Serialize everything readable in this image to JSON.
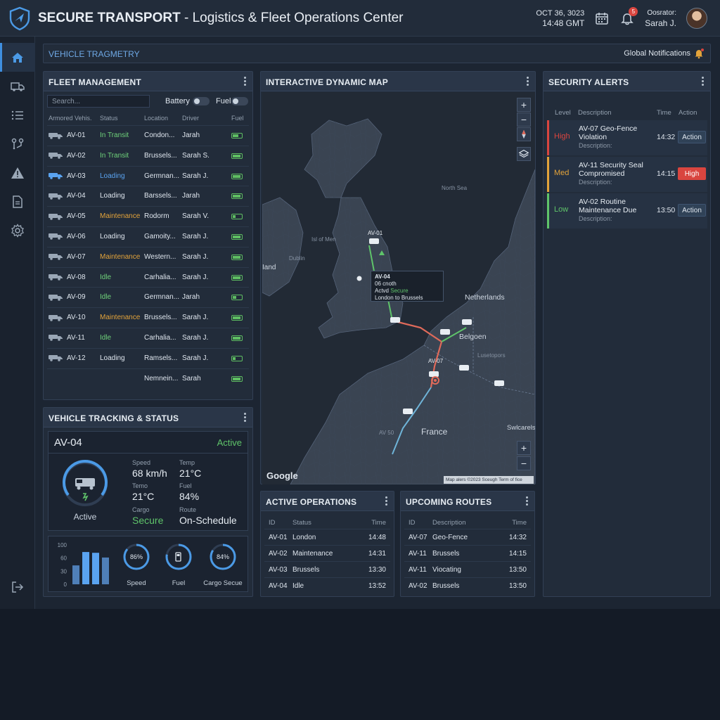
{
  "header": {
    "brand": "SECURE TRANSPORT",
    "subtitle": " - Logistics & Fleet Operations Center",
    "date": "OCT 36, 3023",
    "time": "14:48 GMT",
    "notification_count": "5",
    "operator_label": "Oosrator:",
    "operator_name": "Sarah J."
  },
  "sidebar": {
    "items": [
      {
        "icon": "home-icon"
      },
      {
        "icon": "truck-icon"
      },
      {
        "icon": "list-icon"
      },
      {
        "icon": "route-icon"
      },
      {
        "icon": "warning-icon"
      },
      {
        "icon": "document-icon"
      },
      {
        "icon": "gear-icon"
      }
    ],
    "exit_icon": "logout-icon"
  },
  "telemetry_bar": {
    "label": "VEHICLE TRAGMETRY",
    "notifications": "Global Notifications"
  },
  "fleet": {
    "title": "FLEET MANAGEMENT",
    "search_placeholder": "Search...",
    "battery_label": "Battery",
    "fuel_label": "Fuel",
    "columns": [
      "Armored Vehis.",
      "Status",
      "Location",
      "Driver",
      "Fuel"
    ],
    "rows": [
      {
        "id": "AV-01",
        "status": "In Transit",
        "status_kind": "transit",
        "location": "Condon...",
        "driver": "Jarah",
        "fuel": 0.7
      },
      {
        "id": "AV-02",
        "status": "In Transit",
        "status_kind": "transit",
        "location": "Brussels...",
        "driver": "Sarah S.",
        "fuel": 0.9
      },
      {
        "id": "AV-03",
        "status": "Loading",
        "status_kind": "loading-b",
        "location": "Germnan...",
        "driver": "Sarah J.",
        "fuel": 0.9
      },
      {
        "id": "AV-04",
        "status": "Loading",
        "status_kind": "loading",
        "location": "Barssels...",
        "driver": "Jarah",
        "fuel": 0.9
      },
      {
        "id": "AV-05",
        "status": "Maintenance",
        "status_kind": "maint",
        "location": "Rodorm",
        "driver": "Sarah V.",
        "fuel": 0.3
      },
      {
        "id": "AV-06",
        "status": "Loading",
        "status_kind": "loading",
        "location": "Gamoity...",
        "driver": "Sarah J.",
        "fuel": 0.9
      },
      {
        "id": "AV-07",
        "status": "Maintenance",
        "status_kind": "maint",
        "location": "Western...",
        "driver": "Sarah J.",
        "fuel": 0.9
      },
      {
        "id": "AV-08",
        "status": "Idle",
        "status_kind": "idle",
        "location": "Carhalia...",
        "driver": "Sarah J.",
        "fuel": 0.9
      },
      {
        "id": "AV-09",
        "status": "Idle",
        "status_kind": "idle",
        "location": "Germnan...",
        "driver": "Jarah",
        "fuel": 0.4
      },
      {
        "id": "AV-10",
        "status": "Maintenance",
        "status_kind": "maint",
        "location": "Brussels...",
        "driver": "Sarah J.",
        "fuel": 0.9
      },
      {
        "id": "AV-11",
        "status": "Idle",
        "status_kind": "idle",
        "location": "Carhalia...",
        "driver": "Sarah J.",
        "fuel": 0.9
      },
      {
        "id": "AV-12",
        "status": "Loading",
        "status_kind": "loading",
        "location": "Ramsels...",
        "driver": "Sarah J.",
        "fuel": 0.3
      },
      {
        "id": "",
        "status": "",
        "status_kind": "",
        "location": "Nemnein...",
        "driver": "Sarah",
        "fuel": 0.9
      }
    ]
  },
  "tracking": {
    "title": "VEHICLE TRACKING & STATUS",
    "vehicle_id": "AV-04",
    "status": "Active",
    "gauge_label": "Active",
    "stats": [
      {
        "label": "Speed",
        "value": "68 km/h"
      },
      {
        "label": "Temp",
        "value": "21°C"
      },
      {
        "label": "Temo",
        "value": "21°C"
      },
      {
        "label": "Fuel",
        "value": "84%"
      },
      {
        "label": "Cargo",
        "value": "Secure"
      },
      {
        "label": "Route",
        "value": "On-Schedule"
      }
    ],
    "bar_chart": {
      "ticks": [
        "100",
        "60",
        "30",
        "0"
      ],
      "values": [
        48,
        82,
        80,
        68
      ]
    },
    "rings": [
      {
        "label": "Speed",
        "value": "86%",
        "pct": 0.86
      },
      {
        "label": "Fuel",
        "value": "",
        "pct": 0.78
      },
      {
        "label": "Cargo Secue",
        "value": "84%",
        "pct": 0.84
      }
    ]
  },
  "map": {
    "title": "INTERACTIVE DYNAMIC MAP",
    "labels": {
      "north_sea": "North Sea",
      "isle_of_man": "Isl of Men",
      "ireland": "Iand",
      "dublin": "Dublin",
      "netherlands": "Netherlands",
      "belgium": "Belgoen",
      "luxembourg": "Lusetopors",
      "france": "France",
      "switzerland": "Swlcarels"
    },
    "markers": {
      "av01": "AV-01",
      "av07": "AV-07",
      "av50": "AV 50"
    },
    "tooltip": {
      "id": "AV-04",
      "line1": "06 cnoth",
      "status_label": "Actvd",
      "status": "Secure",
      "route": "London to Brussels"
    },
    "attribution": "Google",
    "credit": "Map alers ©2023 Sceugh    Term of fice"
  },
  "alerts": {
    "title": "SECURITY ALERTS",
    "columns": [
      "Level",
      "Description",
      "Time",
      "Action"
    ],
    "rows": [
      {
        "level": "High",
        "color": "#d9453f",
        "line1": "AV-07 Geo-Fence",
        "line2": "Violation",
        "sub": "Description:",
        "time": "14:32",
        "action": "Action",
        "action_red": false
      },
      {
        "level": "Med",
        "color": "#e3a33a",
        "line1": "AV-11 Security Seal",
        "line2": "Compromised",
        "sub": "Description:",
        "time": "14:15",
        "action": "High",
        "action_red": true
      },
      {
        "level": "Low",
        "color": "#5fc46a",
        "line1": "AV-02 Routine",
        "line2": "Maintenance Due",
        "sub": "Description:",
        "time": "13:50",
        "action": "Action",
        "action_red": false
      }
    ]
  },
  "active_ops": {
    "title": "ACTIVE OPERATIONS",
    "columns": [
      "ID",
      "Status",
      "Time"
    ],
    "rows": [
      {
        "id": "AV-01",
        "status": "London",
        "time": "14:48"
      },
      {
        "id": "AV-02",
        "status": "Maintenance",
        "time": "14:31"
      },
      {
        "id": "AV-03",
        "status": "Brussels",
        "time": "13:30"
      },
      {
        "id": "AV-04",
        "status": "Idle",
        "time": "13:52"
      }
    ]
  },
  "upcoming": {
    "title": "UPCOMING ROUTES",
    "columns": [
      "ID",
      "Description",
      "Time"
    ],
    "rows": [
      {
        "id": "AV-07",
        "status": "Geo-Fence",
        "time": "14:32"
      },
      {
        "id": "AV-11",
        "status": "Brussels",
        "time": "14:15"
      },
      {
        "id": "AV-11",
        "status": "Viocating",
        "time": "13:50"
      },
      {
        "id": "AV-02",
        "status": "Brussels",
        "time": "13:50"
      }
    ]
  }
}
